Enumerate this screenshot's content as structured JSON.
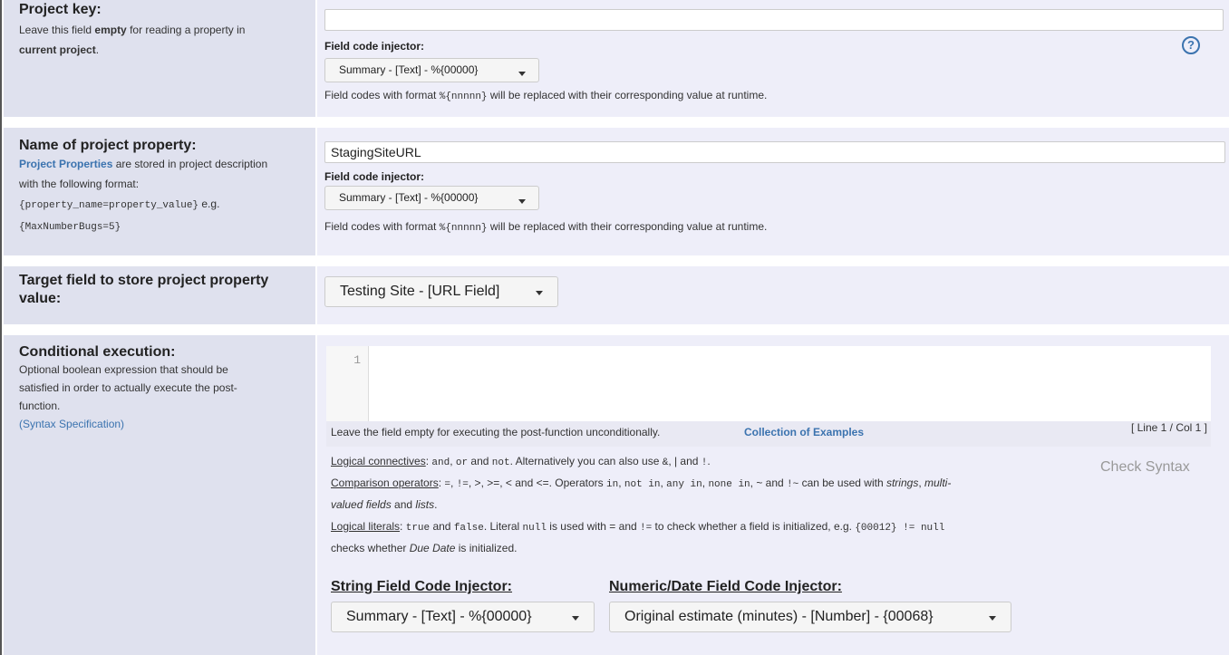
{
  "project_key": {
    "title": "Project key:",
    "desc_1": "Leave this field ",
    "desc_bold_1": "empty",
    "desc_2": " for reading a property in",
    "desc_bold_2": "current project",
    "desc_3": ".",
    "value": "",
    "fci_label": "Field code injector:",
    "fci_value": "Summary - [Text] - %{00000}",
    "help_before": "Field codes with format ",
    "help_code": "%{nnnnn}",
    "help_after": " will be replaced with their corresponding value at runtime.",
    "help_icon": "?"
  },
  "property_name": {
    "title": "Name of project property:",
    "link": "Project Properties",
    "desc_1": " are stored in project description",
    "desc_2": "with the following format:",
    "code_1": "{property_name=property_value}",
    "desc_3": " e.g.",
    "code_2": "{MaxNumberBugs=5}",
    "value": "StagingSiteURL",
    "fci_label": "Field code injector:",
    "fci_value": "Summary - [Text] - %{00000}",
    "help_before": "Field codes with format ",
    "help_code": "%{nnnnn}",
    "help_after": " will be replaced with their corresponding value at runtime."
  },
  "target_field": {
    "title_1": "Target field to store project property",
    "title_2": "value:",
    "value": "Testing Site - [URL Field]"
  },
  "conditional": {
    "title": "Conditional execution:",
    "desc_1": "Optional boolean expression that should be",
    "desc_2": "satisfied in order to actually execute the post-",
    "desc_3": "function.",
    "syntax_link": "(Syntax Specification)",
    "line_number": "1",
    "empty_hint": "Leave the field empty for executing the post-function unconditionally.",
    "examples_link": "Collection of Examples",
    "cursor_pos": "[ Line 1 / Col 1 ]",
    "check_syntax": "Check Syntax",
    "logical_label": "Logical connectives",
    "logical_1": ": ",
    "and": "and",
    "comma": ", ",
    "or": "or",
    "and_word": " and ",
    "not": "not",
    "logical_2": ". Alternatively you can also use ",
    "amp": "&",
    "pipe_and": ", | and ",
    "bang": "!",
    "period": ".",
    "comparison_label": "Comparison operators",
    "comparison_1": ": ",
    "eq": "=",
    "neq": "!=",
    "comparison_2": ", >, >=, < and <=. Operators ",
    "in": "in",
    "not_in": "not in",
    "any_in": "any in",
    "none_in": "none in",
    "comparison_3": ", ~ and ",
    "not_tilde": "!~",
    "comparison_4": " can be used with ",
    "strings": "strings",
    "multi": "multi-",
    "valued_fields": "valued fields",
    "and_lists_1": " and ",
    "lists": "lists",
    "literals_label": "Logical literals",
    "literals_1": ": ",
    "true": "true",
    "false": "false",
    "literals_2": ". Literal ",
    "null": "null",
    "literals_3": " is used with = and ",
    "literals_4": " to check whether a field is initialized, e.g. ",
    "example_code": "{00012} != null",
    "literals_5": "checks whether ",
    "due_date": "Due Date",
    "literals_6": " is initialized.",
    "string_injector_label": "String Field Code Injector:",
    "string_injector_value": "Summary - [Text] - %{00000}",
    "numeric_injector_label": "Numeric/Date Field Code Injector:",
    "numeric_injector_value": "Original estimate (minutes) - [Number] - {00068}"
  }
}
